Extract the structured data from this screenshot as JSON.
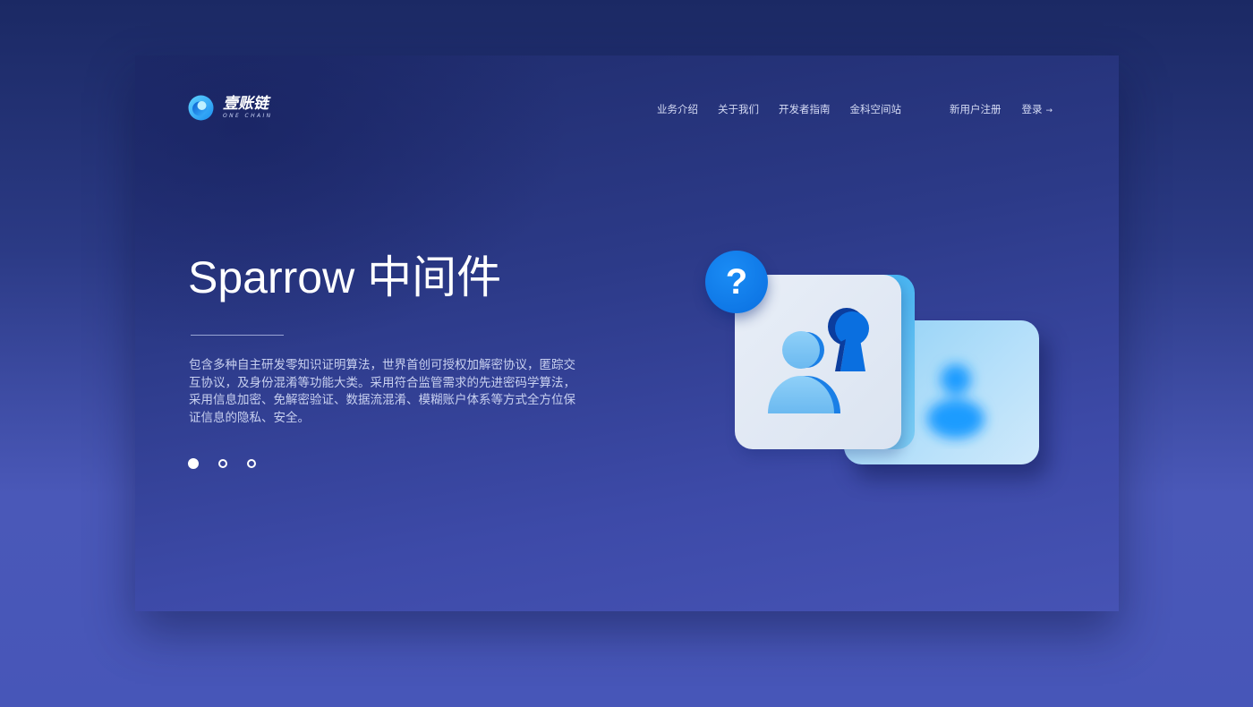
{
  "header": {
    "logo": {
      "name_cn": "壹账链",
      "name_en": "ONE CHAIN",
      "icon": "one-chain-logo-icon"
    },
    "nav": [
      {
        "label": "业务介绍"
      },
      {
        "label": "关于我们"
      },
      {
        "label": "开发者指南"
      },
      {
        "label": "金科空间站"
      }
    ],
    "register_label": "新用户注册",
    "login_label": "登录",
    "login_icon": "arrow-right-icon"
  },
  "hero": {
    "title": "Sparrow 中间件",
    "description": "包含多种自主研发零知识证明算法，世界首创可授权加解密协议，匿踪交互协议，及身份混淆等功能大类。采用符合监管需求的先进密码学算法，采用信息加密、免解密验证、数据流混淆、模糊账户体系等方式全方位保证信息的隐私、安全。",
    "carousel": {
      "total": 3,
      "active_index": 0
    }
  },
  "illustration": {
    "badge_text": "?",
    "icons": [
      "question-badge-icon",
      "user-icon",
      "keyhole-icon",
      "blurred-user-icon"
    ]
  },
  "colors": {
    "background_top": "#1b2964",
    "background_bottom": "#4756b8",
    "accent_blue": "#0a6fe0",
    "light_blue": "#8fd0f5",
    "text_primary": "#ffffff",
    "text_secondary": "#c9d1f0"
  }
}
